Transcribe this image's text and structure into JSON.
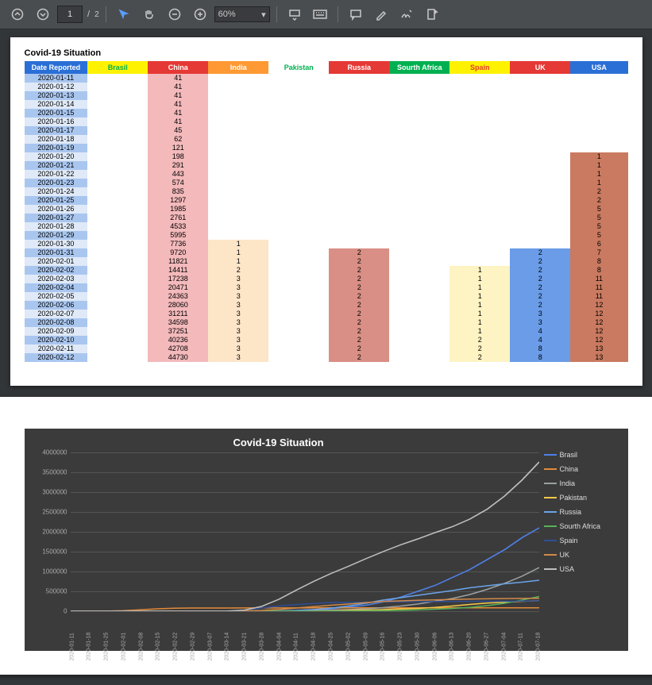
{
  "toolbar": {
    "page_current": "1",
    "page_total": "2",
    "zoom": "60%"
  },
  "doc": {
    "title": "Covid-19 Situation",
    "columns": [
      "Date Reported",
      "Brasil",
      "China",
      "India",
      "Pakistan",
      "Russia",
      "Sourth Africa",
      "Spain",
      "UK",
      "USA"
    ],
    "rows": [
      {
        "d": "2020-01-11",
        "cn": "41"
      },
      {
        "d": "2020-01-12",
        "cn": "41"
      },
      {
        "d": "2020-01-13",
        "cn": "41"
      },
      {
        "d": "2020-01-14",
        "cn": "41"
      },
      {
        "d": "2020-01-15",
        "cn": "41"
      },
      {
        "d": "2020-01-16",
        "cn": "41"
      },
      {
        "d": "2020-01-17",
        "cn": "45"
      },
      {
        "d": "2020-01-18",
        "cn": "62"
      },
      {
        "d": "2020-01-19",
        "cn": "121"
      },
      {
        "d": "2020-01-20",
        "cn": "198",
        "us": "1"
      },
      {
        "d": "2020-01-21",
        "cn": "291",
        "us": "1"
      },
      {
        "d": "2020-01-22",
        "cn": "443",
        "us": "1"
      },
      {
        "d": "2020-01-23",
        "cn": "574",
        "us": "1"
      },
      {
        "d": "2020-01-24",
        "cn": "835",
        "us": "2"
      },
      {
        "d": "2020-01-25",
        "cn": "1297",
        "us": "2"
      },
      {
        "d": "2020-01-26",
        "cn": "1985",
        "us": "5"
      },
      {
        "d": "2020-01-27",
        "cn": "2761",
        "us": "5"
      },
      {
        "d": "2020-01-28",
        "cn": "4533",
        "us": "5"
      },
      {
        "d": "2020-01-29",
        "cn": "5995",
        "us": "5"
      },
      {
        "d": "2020-01-30",
        "cn": "7736",
        "in": "1",
        "us": "6"
      },
      {
        "d": "2020-01-31",
        "cn": "9720",
        "in": "1",
        "ru": "2",
        "uk": "2",
        "us": "7"
      },
      {
        "d": "2020-02-01",
        "cn": "11821",
        "in": "1",
        "ru": "2",
        "uk": "2",
        "us": "8"
      },
      {
        "d": "2020-02-02",
        "cn": "14411",
        "in": "2",
        "ru": "2",
        "es": "1",
        "uk": "2",
        "us": "8"
      },
      {
        "d": "2020-02-03",
        "cn": "17238",
        "in": "3",
        "ru": "2",
        "es": "1",
        "uk": "2",
        "us": "11"
      },
      {
        "d": "2020-02-04",
        "cn": "20471",
        "in": "3",
        "ru": "2",
        "es": "1",
        "uk": "2",
        "us": "11"
      },
      {
        "d": "2020-02-05",
        "cn": "24363",
        "in": "3",
        "ru": "2",
        "es": "1",
        "uk": "2",
        "us": "11"
      },
      {
        "d": "2020-02-06",
        "cn": "28060",
        "in": "3",
        "ru": "2",
        "es": "1",
        "uk": "2",
        "us": "12"
      },
      {
        "d": "2020-02-07",
        "cn": "31211",
        "in": "3",
        "ru": "2",
        "es": "1",
        "uk": "3",
        "us": "12"
      },
      {
        "d": "2020-02-08",
        "cn": "34598",
        "in": "3",
        "ru": "2",
        "es": "1",
        "uk": "3",
        "us": "12"
      },
      {
        "d": "2020-02-09",
        "cn": "37251",
        "in": "3",
        "ru": "2",
        "es": "1",
        "uk": "4",
        "us": "12"
      },
      {
        "d": "2020-02-10",
        "cn": "40236",
        "in": "3",
        "ru": "2",
        "es": "2",
        "uk": "4",
        "us": "12"
      },
      {
        "d": "2020-02-11",
        "cn": "42708",
        "in": "3",
        "ru": "2",
        "es": "2",
        "uk": "8",
        "us": "13"
      },
      {
        "d": "2020-02-12",
        "cn": "44730",
        "in": "3",
        "ru": "2",
        "es": "2",
        "uk": "8",
        "us": "13"
      }
    ]
  },
  "chart_data": {
    "type": "line",
    "title": "Covid-19 Situation",
    "ylim": [
      0,
      4000000
    ],
    "yticks": [
      0,
      500000,
      1000000,
      1500000,
      2000000,
      2500000,
      3000000,
      3500000,
      4000000
    ],
    "x": [
      "2020-01-11",
      "2020-01-18",
      "2020-01-25",
      "2020-02-01",
      "2020-02-08",
      "2020-02-15",
      "2020-02-22",
      "2020-02-29",
      "2020-03-07",
      "2020-03-14",
      "2020-03-21",
      "2020-03-28",
      "2020-04-04",
      "2020-04-11",
      "2020-04-18",
      "2020-04-25",
      "2020-05-02",
      "2020-05-09",
      "2020-05-16",
      "2020-05-23",
      "2020-05-30",
      "2020-06-06",
      "2020-06-13",
      "2020-06-20",
      "2020-06-27",
      "2020-07-04",
      "2020-07-11",
      "2020-07-18"
    ],
    "series": [
      {
        "name": "Brasil",
        "color": "#4f81e8",
        "values": [
          0,
          0,
          0,
          0,
          0,
          0,
          0,
          0,
          0,
          0,
          100,
          1000,
          7000,
          20000,
          40000,
          60000,
          100000,
          150000,
          230000,
          350000,
          500000,
          650000,
          850000,
          1050000,
          1300000,
          1550000,
          1850000,
          2100000
        ]
      },
      {
        "name": "China",
        "color": "#e38b3a",
        "values": [
          41,
          62,
          2000,
          12000,
          35000,
          60000,
          75000,
          80000,
          81000,
          81000,
          82000,
          82000,
          83000,
          83000,
          84000,
          84000,
          84000,
          84000,
          84000,
          84000,
          84000,
          85000,
          85000,
          85000,
          85000,
          85000,
          86000,
          86000
        ]
      },
      {
        "name": "India",
        "color": "#9aa0a0",
        "values": [
          0,
          0,
          0,
          1,
          3,
          3,
          3,
          3,
          30,
          100,
          300,
          1000,
          3000,
          8000,
          16000,
          25000,
          40000,
          60000,
          90000,
          130000,
          180000,
          250000,
          320000,
          420000,
          550000,
          700000,
          880000,
          1100000
        ]
      },
      {
        "name": "Pakistan",
        "color": "#f7c948",
        "values": [
          0,
          0,
          0,
          0,
          0,
          0,
          0,
          0,
          5,
          30,
          600,
          1500,
          3000,
          5000,
          8000,
          12000,
          20000,
          30000,
          40000,
          55000,
          70000,
          95000,
          130000,
          170000,
          205000,
          225000,
          250000,
          265000
        ]
      },
      {
        "name": "Russia",
        "color": "#6aa4e8",
        "values": [
          0,
          0,
          0,
          2,
          2,
          2,
          2,
          2,
          10,
          60,
          300,
          1500,
          5000,
          15000,
          40000,
          75000,
          130000,
          200000,
          280000,
          340000,
          400000,
          460000,
          520000,
          590000,
          640000,
          690000,
          730000,
          780000
        ]
      },
      {
        "name": "Sourth Africa",
        "color": "#58b158",
        "values": [
          0,
          0,
          0,
          0,
          0,
          0,
          0,
          0,
          0,
          30,
          250,
          1200,
          1700,
          2200,
          3000,
          4500,
          6000,
          9000,
          14000,
          21000,
          32000,
          50000,
          70000,
          95000,
          140000,
          200000,
          280000,
          370000
        ]
      },
      {
        "name": "Spain",
        "color": "#2f4e95",
        "values": [
          0,
          0,
          0,
          0,
          1,
          2,
          2,
          25,
          400,
          5000,
          25000,
          80000,
          130000,
          165000,
          195000,
          220000,
          218000,
          225000,
          232000,
          236000,
          240000,
          242000,
          244000,
          247000,
          249000,
          251000,
          255000,
          262000
        ]
      },
      {
        "name": "UK",
        "color": "#d08a4a",
        "values": [
          0,
          0,
          0,
          2,
          3,
          9,
          13,
          23,
          200,
          1100,
          5000,
          17000,
          42000,
          80000,
          115000,
          150000,
          180000,
          215000,
          245000,
          260000,
          275000,
          285000,
          295000,
          305000,
          312000,
          317000,
          322000,
          326000
        ]
      },
      {
        "name": "USA",
        "color": "#bfbfbf",
        "values": [
          1,
          1,
          5,
          8,
          12,
          15,
          15,
          70,
          400,
          2700,
          25000,
          120000,
          300000,
          530000,
          750000,
          950000,
          1130000,
          1320000,
          1500000,
          1670000,
          1820000,
          1980000,
          2130000,
          2320000,
          2570000,
          2900000,
          3300000,
          3760000
        ]
      }
    ]
  }
}
